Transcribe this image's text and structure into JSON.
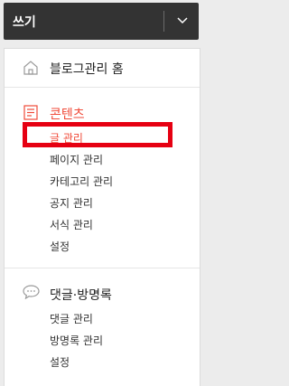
{
  "write_bar": {
    "label": "쓰기"
  },
  "sidebar": {
    "home": {
      "label": "블로그관리 홈"
    },
    "contents": {
      "title": "콘텐츠",
      "items": [
        "글 관리",
        "페이지 관리",
        "카테고리 관리",
        "공지 관리",
        "서식 관리",
        "설정"
      ],
      "active_item": "글 관리"
    },
    "comments": {
      "title": "댓글·방명록",
      "items": [
        "댓글 관리",
        "방명록 관리",
        "설정"
      ]
    }
  },
  "colors": {
    "accent": "#f04a38",
    "highlight_box": "#e60012",
    "write_bar": "#333333"
  },
  "icons": {
    "home": "home-icon",
    "contents": "document-icon",
    "comments": "speech-bubble-icon",
    "dropdown": "chevron-down-icon"
  }
}
